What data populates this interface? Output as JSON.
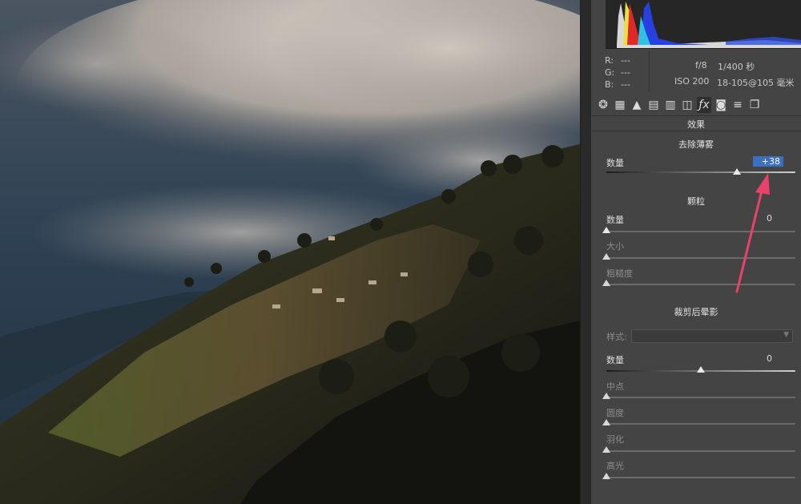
{
  "info": {
    "r_label": "R:",
    "g_label": "G:",
    "b_label": "B:",
    "r_value": "---",
    "g_value": "---",
    "b_value": "---",
    "aperture": "f/8",
    "shutter": "1/400 秒",
    "iso": "ISO 200",
    "lens": "18-105@105 毫米"
  },
  "tools": [
    {
      "icon": "aperture-icon",
      "glyph": "❂"
    },
    {
      "icon": "grid-icon",
      "glyph": "▦"
    },
    {
      "icon": "mountain-icon",
      "glyph": "▲"
    },
    {
      "icon": "split-toning-icon",
      "glyph": "▤"
    },
    {
      "icon": "detail-icon",
      "glyph": "▥"
    },
    {
      "icon": "lens-icon",
      "glyph": "◫"
    },
    {
      "icon": "fx-icon",
      "glyph": "ƒx"
    },
    {
      "icon": "camera-icon",
      "glyph": "◙"
    },
    {
      "icon": "sliders-icon",
      "glyph": "≡"
    },
    {
      "icon": "presets-icon",
      "glyph": "❐"
    }
  ],
  "panel_title": "效果",
  "dehaze": {
    "title": "去除薄雾",
    "amount_label": "数量",
    "amount_value": "+38",
    "amount": 38
  },
  "grain": {
    "title": "颗粒",
    "amount_label": "数量",
    "amount_value": "0",
    "size_label": "大小",
    "roughness_label": "粗糙度"
  },
  "vignette": {
    "title": "裁剪后晕影",
    "style_label": "样式:",
    "amount_label": "数量",
    "amount_value": "0",
    "midpoint_label": "中点",
    "roundness_label": "圆度",
    "feather_label": "羽化",
    "highlights_label": "高光"
  },
  "colors": {
    "accent": "#3d6fc0",
    "arrow": "#e8426c"
  }
}
